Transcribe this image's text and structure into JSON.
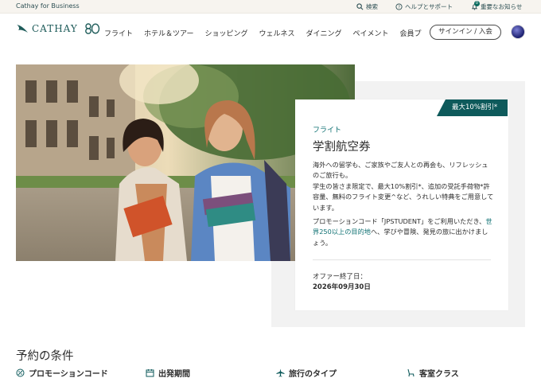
{
  "topbar": {
    "business": "Cathay for Business",
    "search": "検索",
    "help": "ヘルプとサポート",
    "notice": "重要なお知らせ",
    "notice_count": "0"
  },
  "brand": {
    "name": "CATHAY"
  },
  "nav": {
    "items": [
      "フライト",
      "ホテル＆ツアー",
      "ショッピング",
      "ウェルネス",
      "ダイニング",
      "ペイメント",
      "会員プ"
    ],
    "signin": "サインイン / 入会"
  },
  "offer": {
    "ribbon": "最大10%割引*",
    "category": "フライト",
    "title": "学割航空券",
    "desc_1": "海外への留学も、ご家族やご友人との再会も、リフレッシュのご旅行も。",
    "desc_2": "学生の皆さま限定で、最大10%割引*、追加の受託手荷物*許容量、無料のフライト変更^など、うれしい特典をご用意しています。",
    "promo_1": "プロモーションコード「JPSTUDENT」をご利用いただき、",
    "promo_link": "世界250以上の目的地",
    "promo_2": "へ、学びや冒険、発見の旅に出かけましょう。",
    "end_label": "オファー終了日：",
    "end_date": "2026年09月30日"
  },
  "conditions": {
    "title": "予約の条件",
    "items": [
      {
        "label": "プロモーションコード",
        "icon": "tag-icon"
      },
      {
        "label": "出発期間",
        "icon": "calendar-icon"
      },
      {
        "label": "旅行のタイプ",
        "icon": "plane-icon"
      },
      {
        "label": "客室クラス",
        "icon": "seat-icon"
      }
    ]
  },
  "colors": {
    "accent": "#0e5a5b",
    "link": "#0e7072",
    "topbar_bg": "#f7f4ef"
  }
}
